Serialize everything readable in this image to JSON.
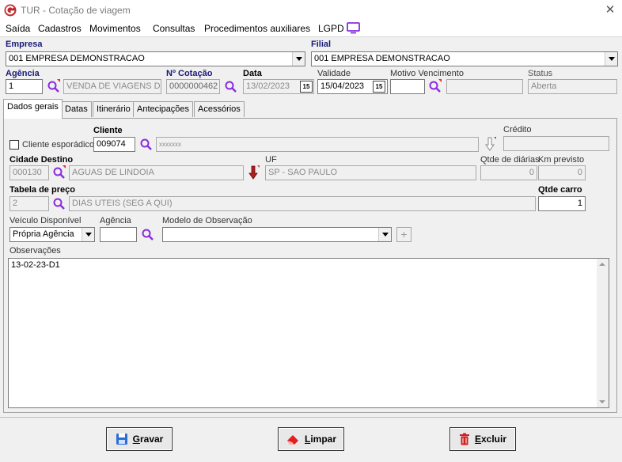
{
  "window": {
    "title": "TUR - Cotação de viagem"
  },
  "menu": {
    "items": [
      "Saída",
      "Cadastros",
      "Movimentos",
      "Consultas",
      "Procedimentos auxiliares",
      "LGPD"
    ]
  },
  "header": {
    "empresa_label": "Empresa",
    "empresa_value": "001 EMPRESA DEMONSTRACAO",
    "filial_label": "Filial",
    "filial_value": "001 EMPRESA DEMONSTRACAO",
    "agencia_label": "Agência",
    "agencia_code": "1",
    "agencia_name": "VENDA DE VIAGENS DE",
    "cotacao_label": "Nº Cotação",
    "cotacao_value": "0000000462",
    "data_label": "Data",
    "data_value": "13/02/2023",
    "validade_label": "Validade",
    "validade_value": "15/04/2023",
    "motivo_label": "Motivo Vencimento",
    "motivo_code": "",
    "motivo_desc": "",
    "status_label": "Status",
    "status_value": "Aberta",
    "cal_label": "15"
  },
  "tabs": [
    "Dados gerais",
    "Datas",
    "Itinerário",
    "Antecipações",
    "Acessórios"
  ],
  "general": {
    "cliente_esporadico": "Cliente esporádico",
    "cliente_label": "Cliente",
    "cliente_code": "009074",
    "cliente_name": "xxxxxxx",
    "credito_label": "Crédito",
    "credito_value": "",
    "cidade_label": "Cidade Destino",
    "cidade_code": "000130",
    "cidade_name": "AGUAS DE LINDOIA",
    "uf_label": "UF",
    "uf_value": "SP - SAO PAULO",
    "diarias_label": "Qtde de diárias",
    "diarias_value": "0",
    "km_label": "Km previsto",
    "km_value": "0",
    "tabela_label": "Tabela de preço",
    "tabela_code": "2",
    "tabela_name": "DIAS UTEIS (SEG A QUI)",
    "qtde_carro_label": "Qtde carro",
    "qtde_carro_value": "1",
    "veiculo_label": "Veículo Disponível",
    "veiculo_value": "Própria Agência",
    "agencia2_label": "Agência",
    "agencia2_value": "",
    "modelo_label": "Modelo de Observação",
    "modelo_value": "",
    "obs_label": "Observações",
    "obs_value": "13-02-23-D1"
  },
  "buttons": {
    "gravar_first": "G",
    "gravar_rest": "ravar",
    "limpar_first": "L",
    "limpar_rest": "impar",
    "excluir_first": "E",
    "excluir_rest": "xcluir"
  },
  "colors": {
    "accent": "#8a2be2",
    "navy_label": "#1a1a7a",
    "brand_red": "#c0282d"
  }
}
